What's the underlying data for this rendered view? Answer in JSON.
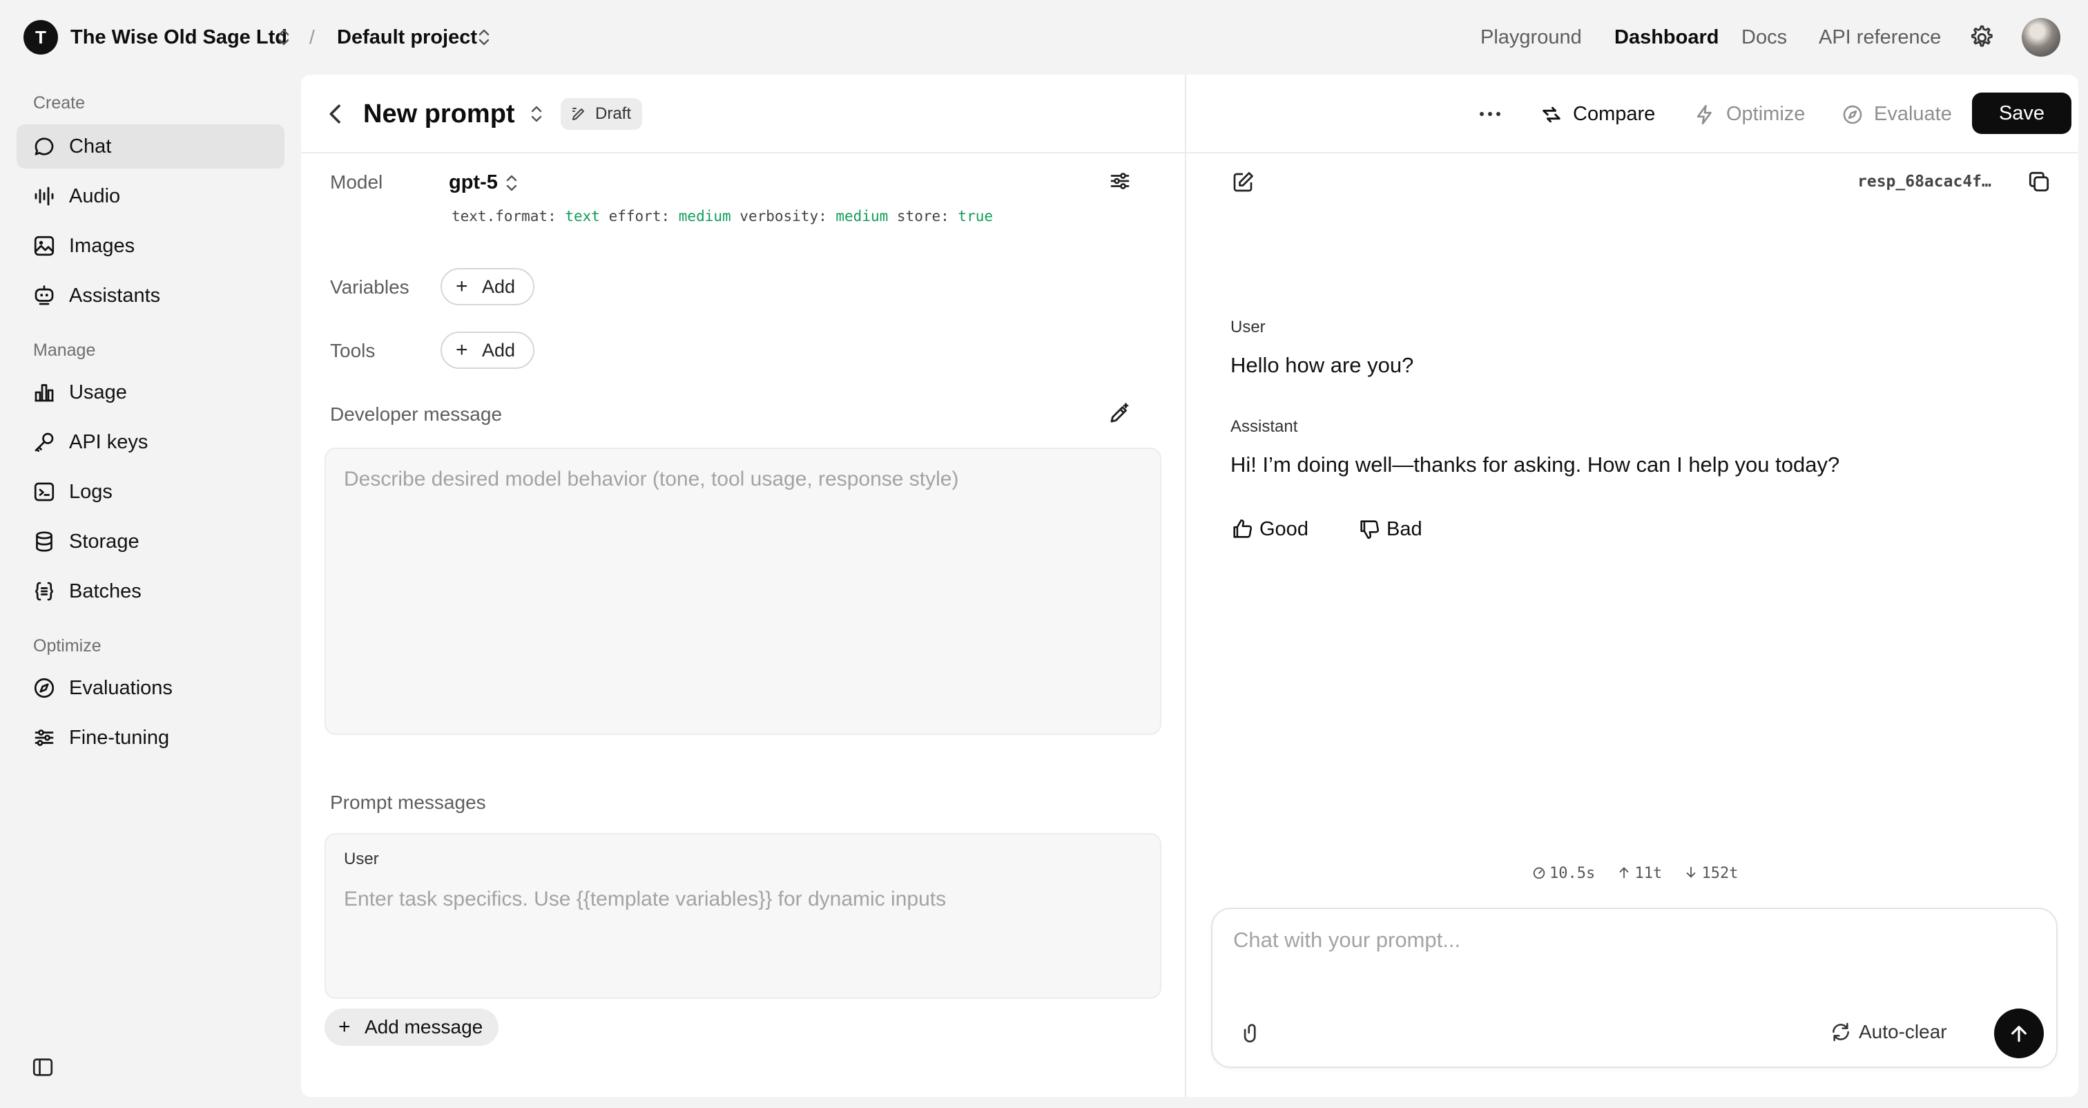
{
  "topbar": {
    "org_initial": "T",
    "org_name": "The Wise Old Sage Ltd",
    "separator": "/",
    "project_name": "Default project",
    "nav": [
      "Playground",
      "Dashboard",
      "Docs",
      "API reference"
    ],
    "active_nav": "Dashboard"
  },
  "sidebar": {
    "sections": {
      "create": "Create",
      "manage": "Manage",
      "optimize": "Optimize"
    },
    "items": {
      "chat": "Chat",
      "audio": "Audio",
      "images": "Images",
      "assistants": "Assistants",
      "usage": "Usage",
      "api_keys": "API keys",
      "logs": "Logs",
      "storage": "Storage",
      "batches": "Batches",
      "evaluations": "Evaluations",
      "fine_tuning": "Fine-tuning"
    },
    "active_item": "Chat"
  },
  "header": {
    "title": "New prompt",
    "badge": "Draft",
    "actions": {
      "compare": "Compare",
      "optimize": "Optimize",
      "evaluate": "Evaluate",
      "save": "Save"
    }
  },
  "config": {
    "model_label": "Model",
    "model": "gpt-5",
    "params": {
      "k1": "text.format:",
      "v1": "text",
      "k2": "effort:",
      "v2": "medium",
      "k3": "verbosity:",
      "v3": "medium",
      "k4": "store:",
      "v4": "true"
    },
    "variables_label": "Variables",
    "tools_label": "Tools",
    "add_label": "Add",
    "developer_label": "Developer message",
    "developer_placeholder": "Describe desired model behavior (tone, tool usage, response style)",
    "prompt_messages_label": "Prompt messages",
    "user_role": "User",
    "user_placeholder": "Enter task specifics. Use {{template variables}} for dynamic inputs",
    "add_message": "Add message"
  },
  "chat": {
    "response_id": "resp_68acac4f…",
    "messages": [
      {
        "role": "User",
        "text": "Hello how are you?"
      },
      {
        "role": "Assistant",
        "text": "Hi! I’m doing well—thanks for asking. How can I help you today?"
      }
    ],
    "feedback": {
      "good": "Good",
      "bad": "Bad"
    },
    "stats": {
      "time": "10.5s",
      "in_tokens": "11t",
      "out_tokens": "152t"
    },
    "input_placeholder": "Chat with your prompt...",
    "autoclear": "Auto-clear"
  },
  "colors": {
    "accent_dark": "#0d0d0d",
    "param_value_green": "#0f9d58",
    "sidebar_active": "#e4e4e4"
  }
}
